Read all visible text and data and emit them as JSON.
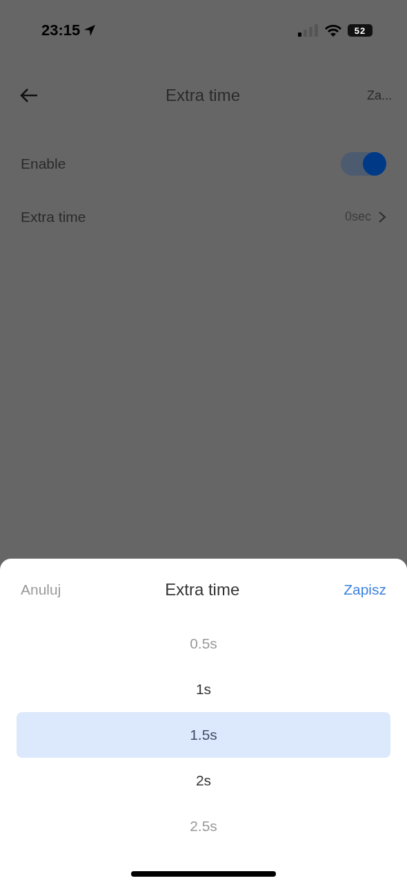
{
  "status_bar": {
    "time": "23:15",
    "battery": "52"
  },
  "header": {
    "title": "Extra time",
    "action": "Za..."
  },
  "settings": [
    {
      "kind": "toggle",
      "label": "Enable",
      "on": true
    },
    {
      "kind": "link",
      "label": "Extra time",
      "value": "0sec"
    }
  ],
  "sheet": {
    "cancel": "Anuluj",
    "title": "Extra time",
    "save": "Zapisz",
    "options": [
      {
        "label": "0.5s",
        "selected": false
      },
      {
        "label": "1s",
        "selected": false
      },
      {
        "label": "1.5s",
        "selected": true
      },
      {
        "label": "2s",
        "selected": false
      },
      {
        "label": "2.5s",
        "selected": false
      }
    ]
  }
}
